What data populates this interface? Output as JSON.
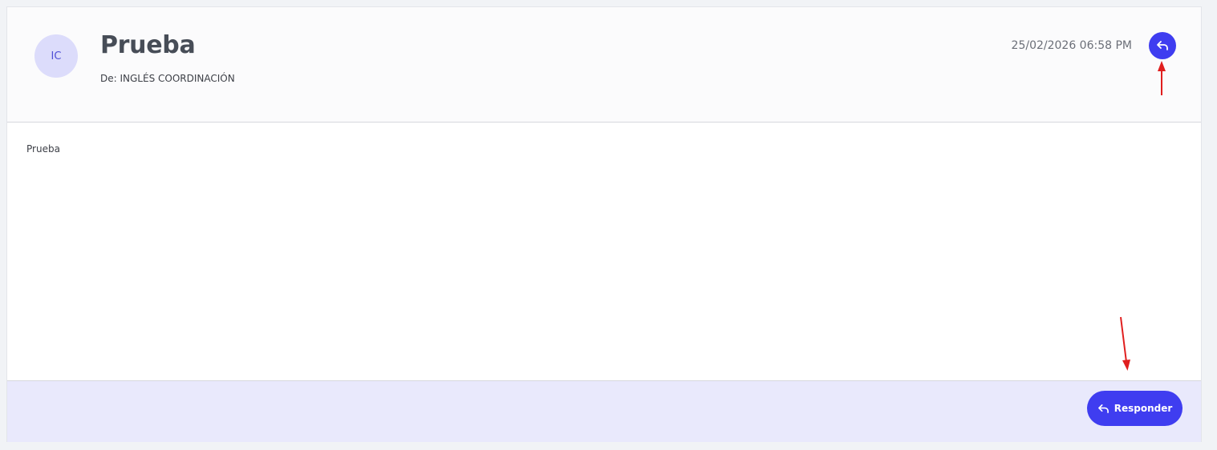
{
  "message": {
    "avatar_initials": "IC",
    "subject": "Prueba",
    "sender": "De: INGLÉS COORDINACIÓN",
    "date": "25/02/2026 06:58 PM",
    "body": "Prueba"
  },
  "actions": {
    "reply_icon": "reply-icon",
    "reply_label": "Responder"
  },
  "colors": {
    "accent": "#3f3df0",
    "avatar_bg": "#dcdcfb",
    "footer_bg": "#e9e9fc",
    "annotation_arrow": "#e01e1e"
  }
}
